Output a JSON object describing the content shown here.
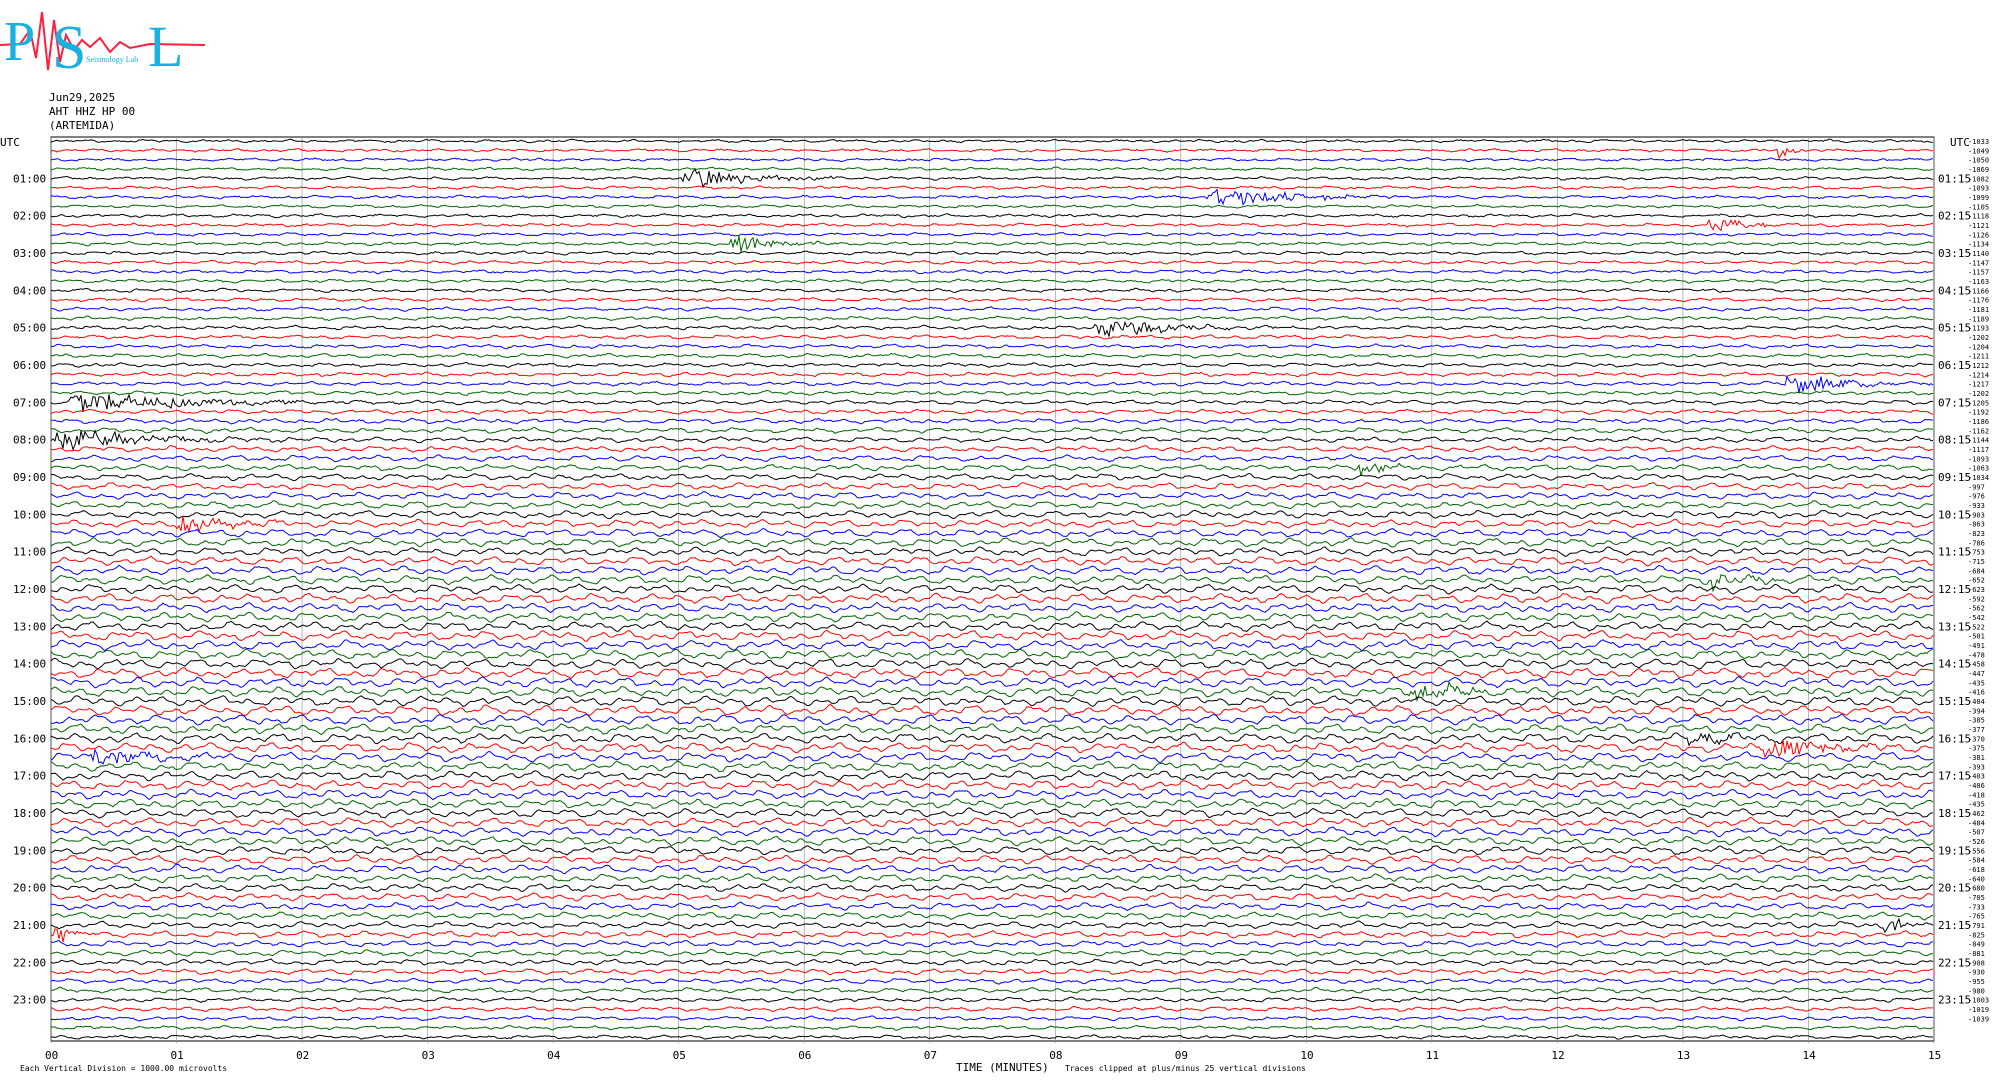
{
  "logo": {
    "letters": [
      "P",
      "S",
      "L"
    ],
    "sub_text": "Seismology Lab"
  },
  "header": {
    "date": "Jun29,2025",
    "station": "AHT HHZ HP 00",
    "location": "(ARTEMIDA)"
  },
  "chart_data": {
    "type": "line",
    "title": "Jun29,2025 AHT HHZ HP 00 (ARTEMIDA)",
    "left_label": "UTC",
    "right_label": "UTC",
    "xlabel": "TIME (MINUTES)",
    "x_ticks": [
      "00",
      "01",
      "02",
      "03",
      "04",
      "05",
      "06",
      "07",
      "08",
      "09",
      "10",
      "11",
      "12",
      "13",
      "14",
      "15"
    ],
    "xlim": [
      0,
      15
    ],
    "rows_per_hour": 4,
    "row_count": 97,
    "trace_colors": [
      "#000000",
      "#ff0000",
      "#0000ff",
      "#006400"
    ],
    "left_hour_labels": [
      "01:00",
      "02:00",
      "03:00",
      "04:00",
      "05:00",
      "06:00",
      "07:00",
      "08:00",
      "09:00",
      "10:00",
      "11:00",
      "12:00",
      "13:00",
      "14:00",
      "15:00",
      "16:00",
      "17:00",
      "18:00",
      "19:00",
      "20:00",
      "21:00",
      "22:00",
      "23:00"
    ],
    "right_hour_labels": [
      "01:15",
      "02:15",
      "03:15",
      "04:15",
      "05:15",
      "06:15",
      "07:15",
      "08:15",
      "09:15",
      "10:15",
      "11:15",
      "12:15",
      "13:15",
      "14:15",
      "15:15",
      "16:15",
      "17:15",
      "18:15",
      "19:15",
      "20:15",
      "21:15",
      "22:15",
      "23:15"
    ],
    "trace_offsets": [
      -1033,
      -1049,
      -1050,
      -1069,
      -1082,
      -1093,
      -1099,
      -1105,
      -1118,
      -1121,
      -1126,
      -1134,
      -1140,
      -1147,
      -1157,
      -1163,
      -1166,
      -1176,
      -1181,
      -1189,
      -1193,
      -1202,
      -1204,
      -1211,
      -1212,
      -1214,
      -1217,
      -1202,
      -1205,
      -1192,
      -1186,
      -1162,
      -1144,
      -1117,
      -1093,
      -1063,
      -1034,
      -997,
      -976,
      -933,
      -903,
      -863,
      -823,
      -786,
      -753,
      -715,
      -684,
      -652,
      -623,
      -592,
      -562,
      -542,
      -522,
      -501,
      -491,
      -478,
      -458,
      -447,
      -435,
      -416,
      -404,
      -394,
      -385,
      -377,
      -370,
      -375,
      -381,
      -393,
      -403,
      -406,
      -418,
      -435,
      -462,
      -484,
      -507,
      -526,
      -556,
      -584,
      -618,
      -640,
      -680,
      -705,
      -733,
      -765,
      -791,
      -825,
      -849,
      -881,
      -908,
      -930,
      -955,
      -980,
      -1003,
      -1019,
      -1039
    ],
    "events": [
      {
        "row": 1,
        "start_min": 13.75,
        "end_min": 14.0
      },
      {
        "row": 4,
        "start_min": 5.0,
        "end_min": 6.6
      },
      {
        "row": 6,
        "start_min": 9.2,
        "end_min": 10.9
      },
      {
        "row": 9,
        "start_min": 13.2,
        "end_min": 13.8
      },
      {
        "row": 11,
        "start_min": 5.4,
        "end_min": 6.3
      },
      {
        "row": 20,
        "start_min": 8.3,
        "end_min": 9.8
      },
      {
        "row": 26,
        "start_min": 13.8,
        "end_min": 15.0
      },
      {
        "row": 28,
        "start_min": 0.1,
        "end_min": 2.7
      },
      {
        "row": 32,
        "start_min": 0.0,
        "end_min": 1.9
      },
      {
        "row": 35,
        "start_min": 10.4,
        "end_min": 10.9
      },
      {
        "row": 41,
        "start_min": 1.0,
        "end_min": 2.0
      },
      {
        "row": 47,
        "start_min": 13.2,
        "end_min": 13.9
      },
      {
        "row": 59,
        "start_min": 10.8,
        "end_min": 11.8
      },
      {
        "row": 64,
        "start_min": 13.0,
        "end_min": 13.8
      },
      {
        "row": 65,
        "start_min": 13.6,
        "end_min": 15.0
      },
      {
        "row": 66,
        "start_min": 0.3,
        "end_min": 1.4
      },
      {
        "row": 84,
        "start_min": 14.6,
        "end_min": 15.0
      },
      {
        "row": 85,
        "start_min": 0.0,
        "end_min": 0.4
      }
    ],
    "footer_left": "Each Vertical Division = 1000.00 microvolts",
    "footer_right": "Traces clipped at plus/minus 25 vertical divisions"
  }
}
